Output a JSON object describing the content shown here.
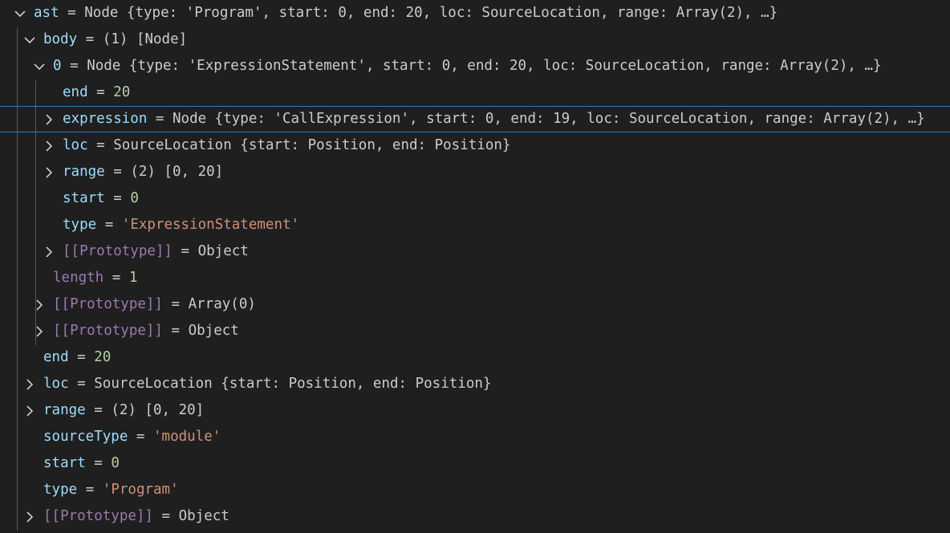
{
  "rows": [
    {
      "key": "ast",
      "value": "Node {type: 'Program', start: 0, end: 20, loc: SourceLocation, range: Array(2), …}"
    },
    {
      "key": "body",
      "value": "(1) [Node]"
    },
    {
      "key": "0",
      "value": "Node {type: 'ExpressionStatement', start: 0, end: 20, loc: SourceLocation, range: Array(2), …}"
    },
    {
      "key": "end",
      "value": "20"
    },
    {
      "key": "expression",
      "value": "Node {type: 'CallExpression', start: 0, end: 19, loc: SourceLocation, range: Array(2), …}"
    },
    {
      "key": "loc",
      "value": "SourceLocation {start: Position, end: Position}"
    },
    {
      "key": "range",
      "value": "(2) [0, 20]"
    },
    {
      "key": "start",
      "value": "0"
    },
    {
      "key": "type",
      "value": "'ExpressionStatement'"
    },
    {
      "key": "[[Prototype]]",
      "value": "Object"
    },
    {
      "key": "length",
      "value": "1"
    },
    {
      "key": "[[Prototype]]",
      "value": "Array(0)"
    },
    {
      "key": "[[Prototype]]",
      "value": "Object"
    },
    {
      "key": "end",
      "value": "20"
    },
    {
      "key": "loc",
      "value": "SourceLocation {start: Position, end: Position}"
    },
    {
      "key": "range",
      "value": "(2) [0, 20]"
    },
    {
      "key": "sourceType",
      "value": "'module'"
    },
    {
      "key": "start",
      "value": "0"
    },
    {
      "key": "type",
      "value": "'Program'"
    },
    {
      "key": "[[Prototype]]",
      "value": "Object"
    }
  ],
  "separator": "=",
  "colors": {
    "background": "#1f1f1f",
    "key": "#9cdcfe",
    "internal_key": "#9a7ab0",
    "number": "#b5cea8",
    "string": "#ce9178",
    "text": "#cccccc",
    "focus_border": "#2b79c2",
    "indent_guide": "#585858"
  },
  "icons": {
    "expanded": "chevron-down-icon",
    "collapsed": "chevron-right-icon"
  }
}
